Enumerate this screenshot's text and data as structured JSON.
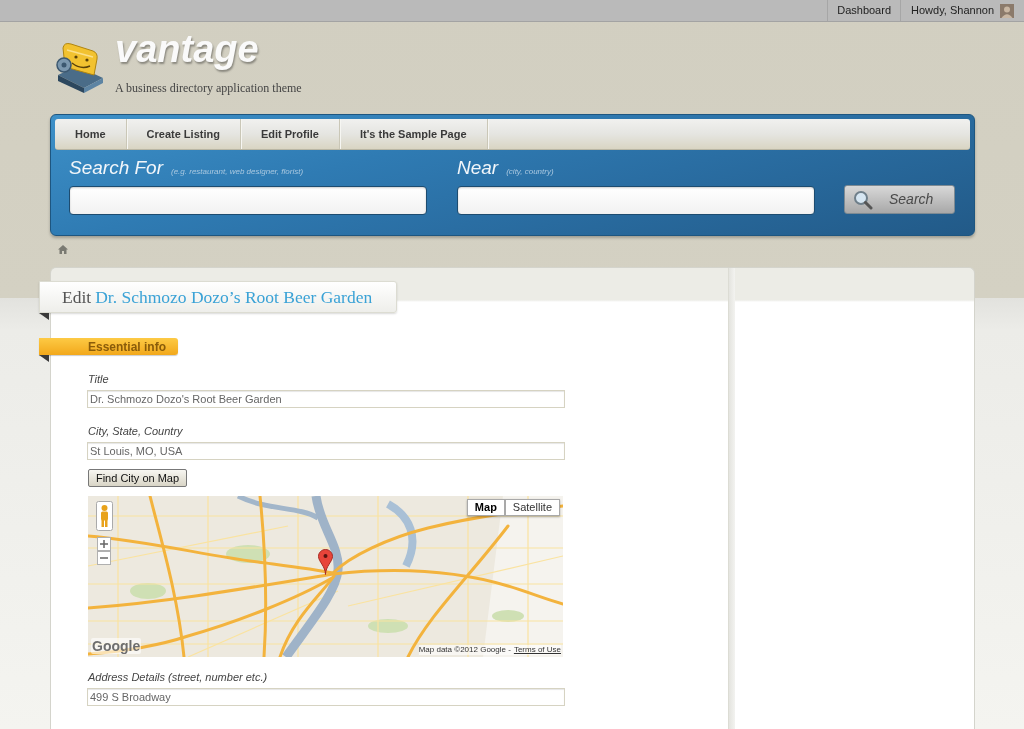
{
  "admin_bar": {
    "links": [
      {
        "kind": "link",
        "label": "Dashboard"
      },
      {
        "kind": "account",
        "label": "Howdy, Shannon"
      }
    ]
  },
  "site": {
    "title": "vantage",
    "tagline": "A business directory application theme"
  },
  "nav": {
    "items": [
      {
        "label": "Home"
      },
      {
        "label": "Create Listing"
      },
      {
        "label": "Edit Profile"
      },
      {
        "label": "It's the Sample Page"
      }
    ]
  },
  "search": {
    "fields": [
      {
        "label": "Search For",
        "hint": "(e.g. restaurant, web designer, florist)"
      },
      {
        "label": "Near",
        "hint": "(city, country)"
      }
    ],
    "button": "Search"
  },
  "page": {
    "prefix": "Edit",
    "title": "Dr. Schmozo Dozo’s Root Beer Garden"
  },
  "section": {
    "label": "Essential info"
  },
  "form": {
    "fields": [
      {
        "kind": "text",
        "label": "Title",
        "value": "Dr. Schmozo Dozo's Root Beer Garden"
      },
      {
        "kind": "text",
        "label": "City, State, Country",
        "value": "St Louis, MO, USA"
      },
      {
        "kind": "button",
        "label": "Find City on Map"
      },
      {
        "kind": "map",
        "map_types": [
          {
            "label": "Map",
            "selected": true
          },
          {
            "label": "Satellite",
            "selected": false
          }
        ],
        "logo": "Google",
        "attribution": "Map data ©2012 Google -",
        "terms": "Terms of Use"
      },
      {
        "kind": "text",
        "label": "Address Details (street, number etc.)",
        "value": "499 S Broadway"
      }
    ]
  }
}
